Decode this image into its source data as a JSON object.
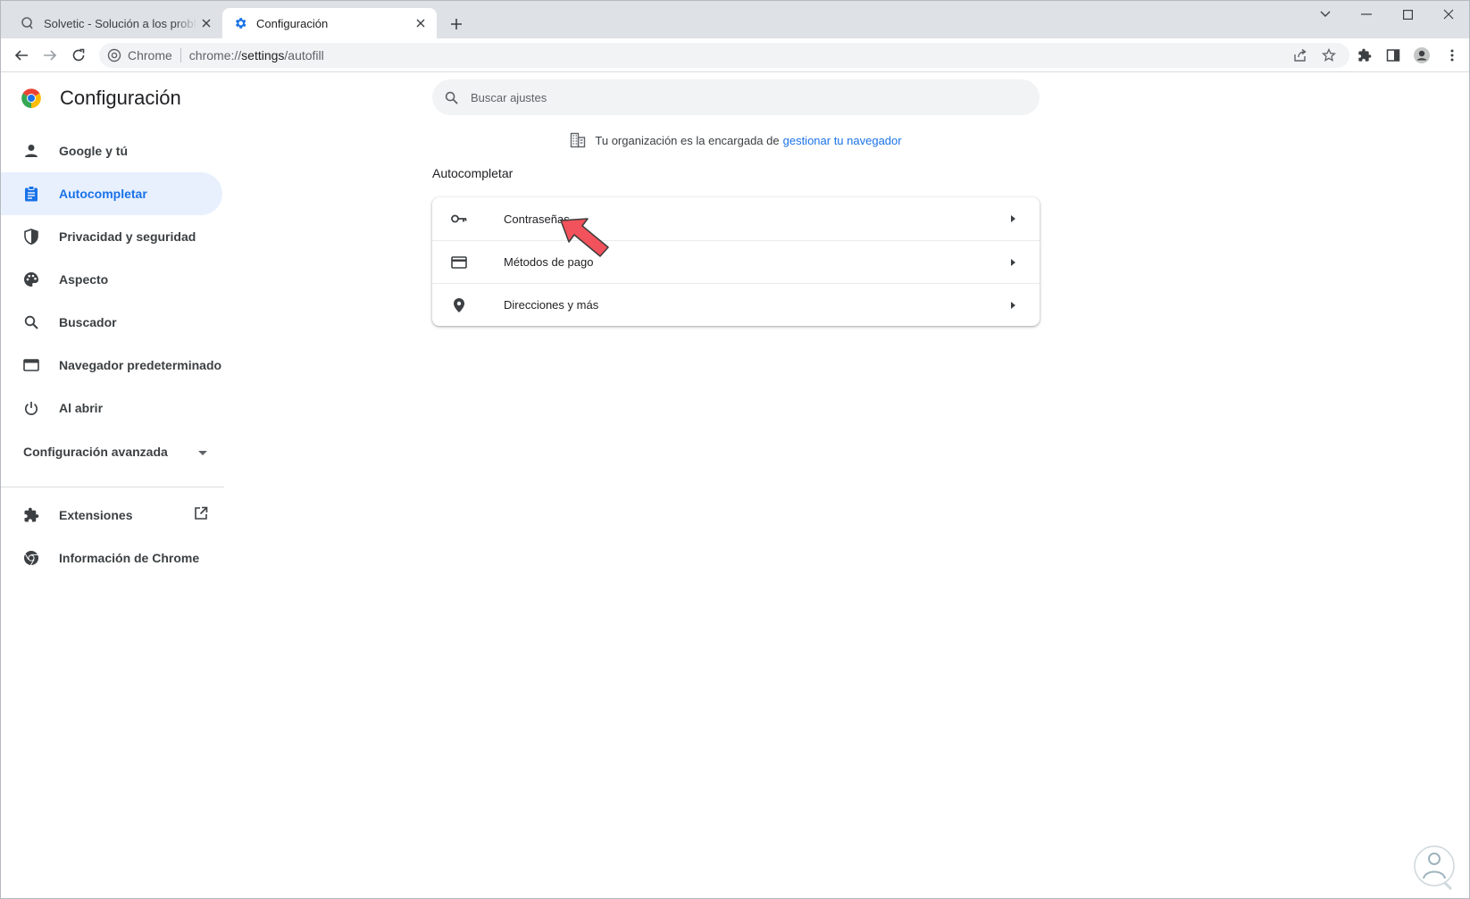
{
  "tabs": [
    {
      "title": "Solvetic - Solución a los problemas informáticos",
      "favicon": "solvetic-icon",
      "active": false
    },
    {
      "title": "Configuración",
      "favicon": "gear-icon",
      "active": true
    }
  ],
  "toolbar": {
    "site_chip": "Chrome",
    "url_scheme": "chrome://",
    "url_host": "settings",
    "url_path": "/autofill"
  },
  "sidebar": {
    "title": "Configuración",
    "items": [
      {
        "label": "Google y tú",
        "icon": "person-icon"
      },
      {
        "label": "Autocompletar",
        "icon": "clipboard-icon",
        "selected": true
      },
      {
        "label": "Privacidad y seguridad",
        "icon": "shield-icon"
      },
      {
        "label": "Aspecto",
        "icon": "palette-icon"
      },
      {
        "label": "Buscador",
        "icon": "search-icon"
      },
      {
        "label": "Navegador predeterminado",
        "icon": "browser-icon"
      },
      {
        "label": "Al abrir",
        "icon": "power-icon"
      }
    ],
    "advanced_label": "Configuración avanzada",
    "extensions_label": "Extensiones",
    "about_label": "Información de Chrome"
  },
  "main": {
    "search_placeholder": "Buscar ajustes",
    "managed_text": "Tu organización es la encargada de",
    "managed_link": "gestionar tu navegador",
    "section_title": "Autocompletar",
    "rows": [
      {
        "label": "Contraseñas",
        "icon": "key-icon"
      },
      {
        "label": "Métodos de pago",
        "icon": "credit-card-icon"
      },
      {
        "label": "Direcciones y más",
        "icon": "location-pin-icon"
      }
    ]
  },
  "colors": {
    "accent": "#1a73e8",
    "selected_bg": "#e8f0fe",
    "tabstrip_bg": "#dee1e6",
    "pointer_red": "#f2525b"
  }
}
